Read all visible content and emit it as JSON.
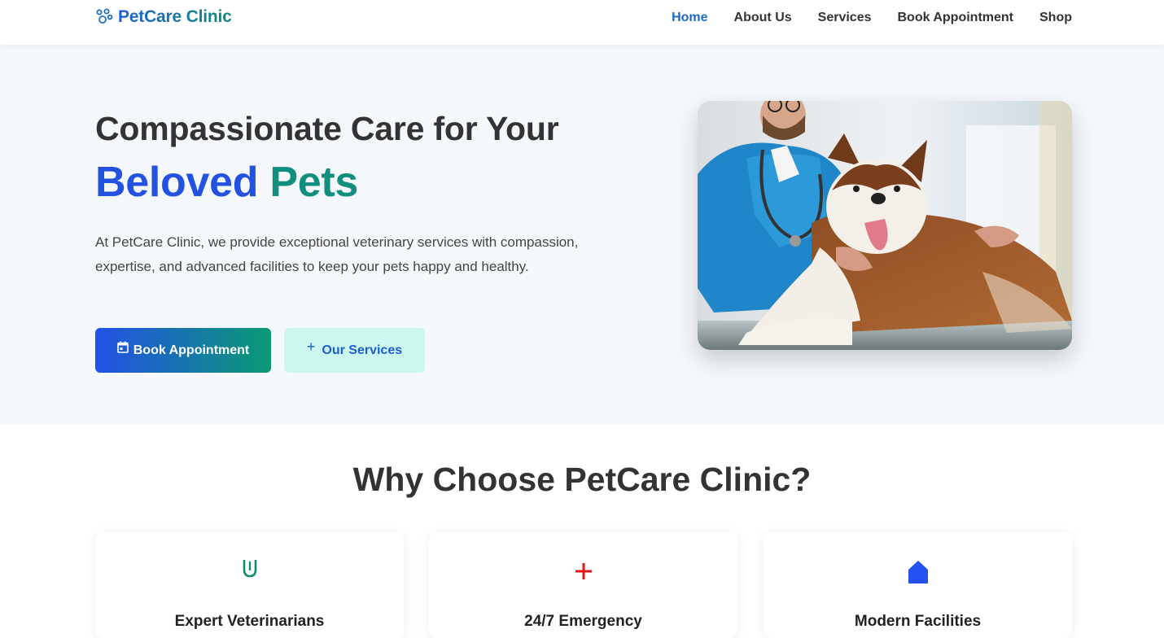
{
  "header": {
    "brand": "PetCare Clinic",
    "nav": [
      {
        "label": "Home",
        "active": true
      },
      {
        "label": "About Us"
      },
      {
        "label": "Services"
      },
      {
        "label": "Book Appointment"
      },
      {
        "label": "Shop"
      }
    ]
  },
  "hero": {
    "title_line1": "Compassionate Care for Your",
    "title_word1": "Beloved",
    "title_word2": "Pets",
    "description": "At PetCare Clinic, we provide exceptional veterinary services with compassion, expertise, and advanced facilities to keep your pets happy and healthy.",
    "primary_button": "Book Appointment",
    "secondary_button": "Our Services",
    "photo_icon": "vet-with-dog-photo"
  },
  "why": {
    "title": "Why Choose PetCare Clinic?",
    "cards": [
      {
        "title": "Expert Veterinarians",
        "icon": "stethoscope-icon",
        "color": "#0e8a6e"
      },
      {
        "title": "24/7 Emergency",
        "icon": "plus-cross-icon",
        "color": "#e01818"
      },
      {
        "title": "Modern Facilities",
        "icon": "house-icon",
        "color": "#2550f0"
      }
    ]
  },
  "colors": {
    "accent_blue": "#2352e0",
    "accent_teal": "#128e7e",
    "nav_active": "#1a6bc0",
    "hero_bg": "#f4f7fb"
  }
}
